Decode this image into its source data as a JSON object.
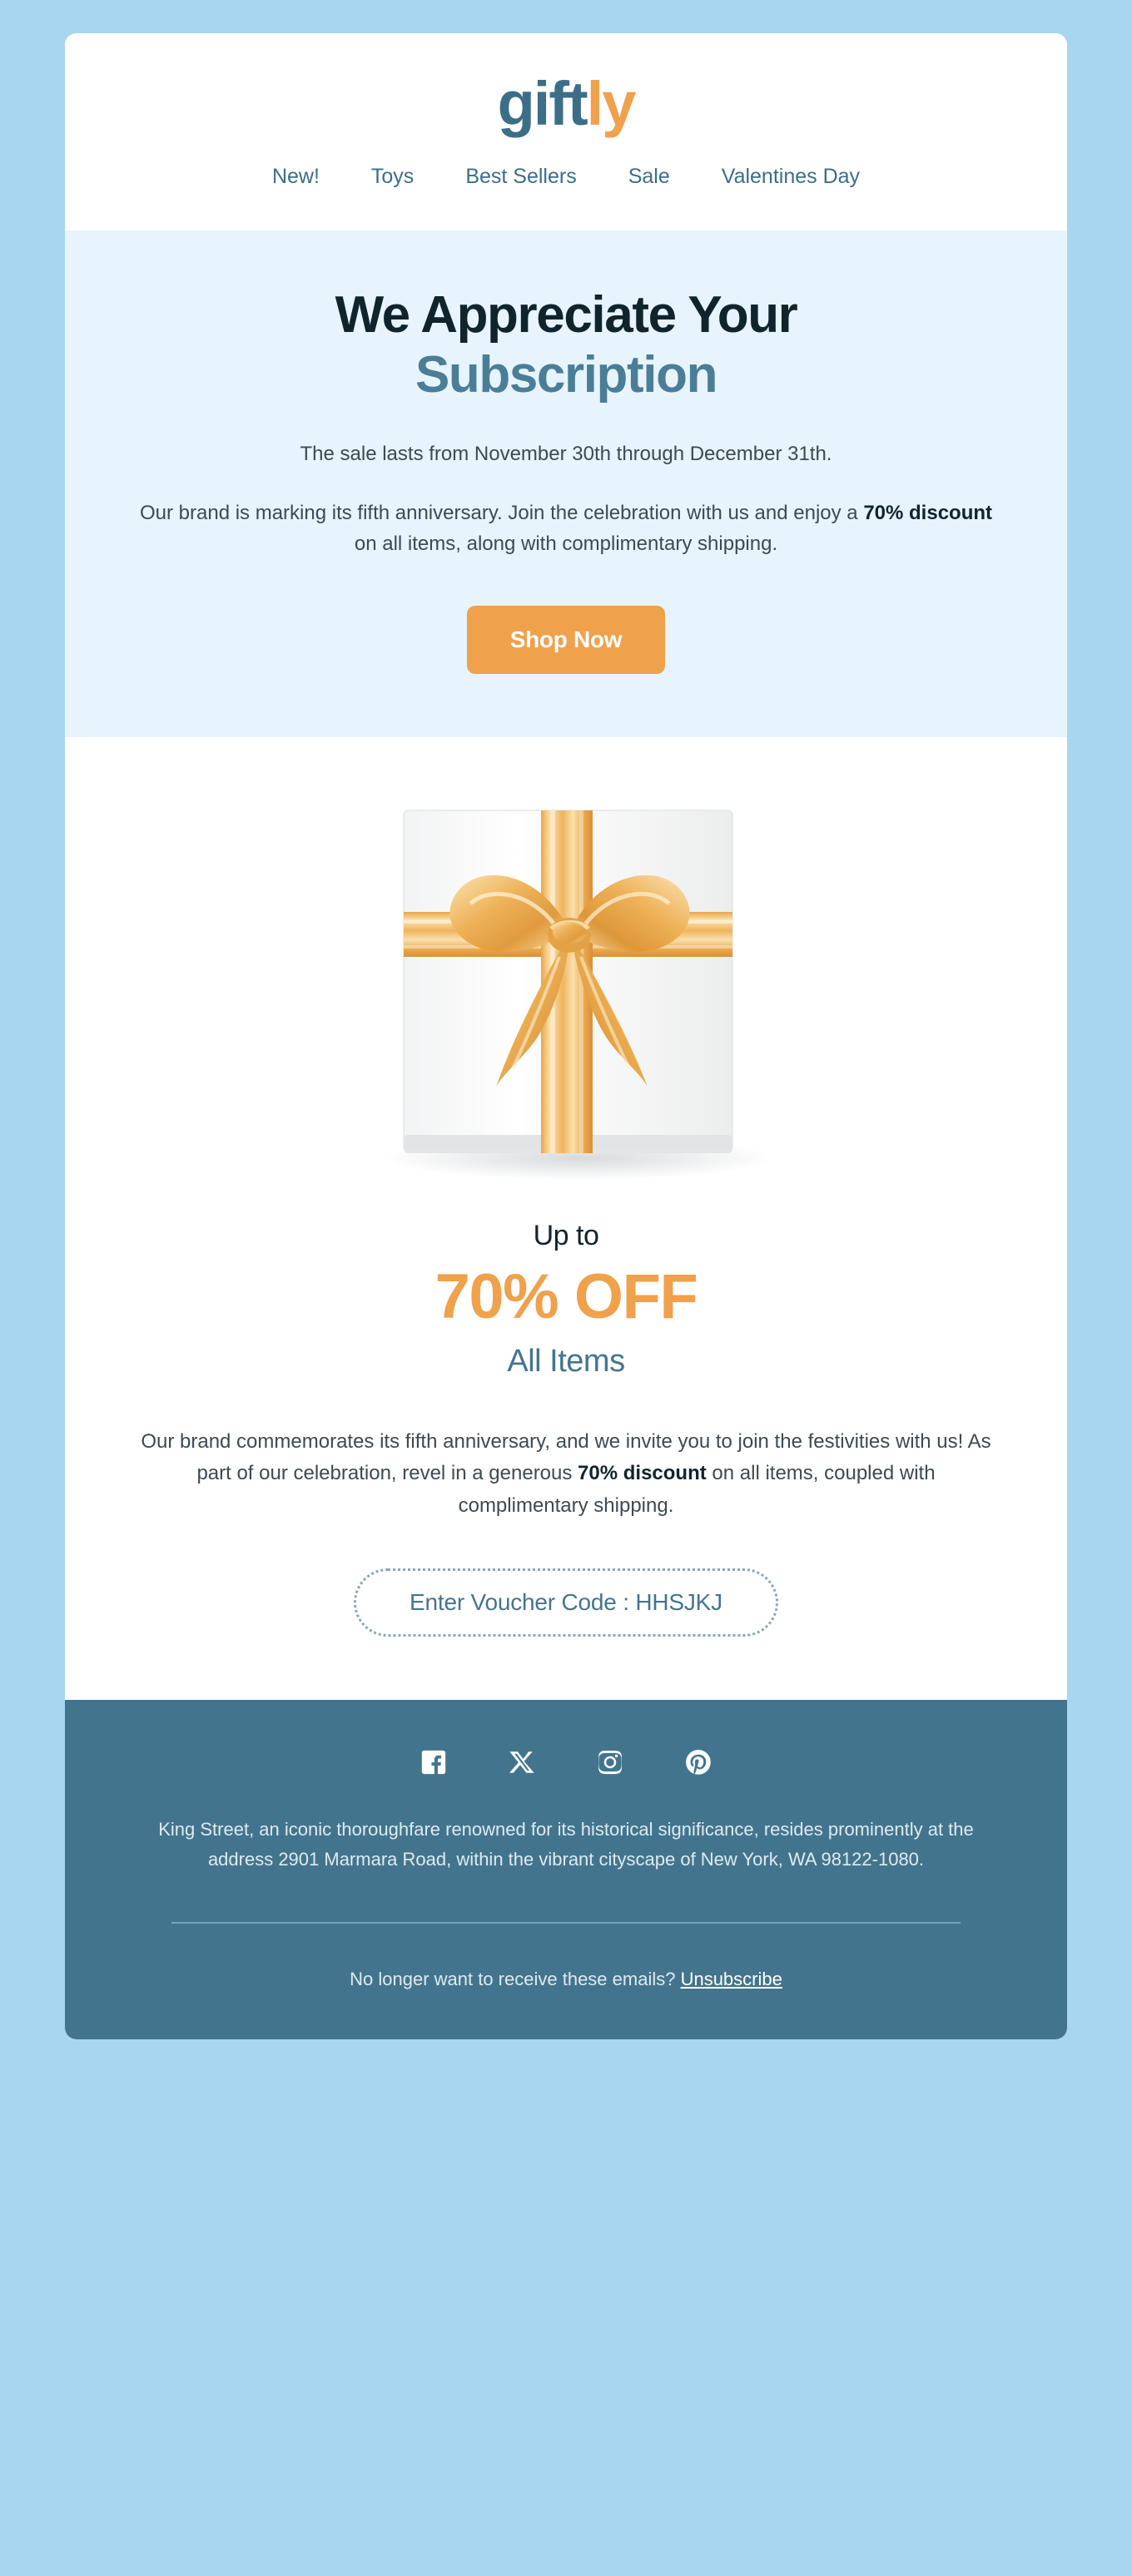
{
  "theme": {
    "page_background": "#a8d6f0",
    "card_background": "#ffffff",
    "hero_background": "#e7f4fd",
    "footer_background": "#42758d",
    "accent_orange": "#efa14c",
    "accent_slate": "#44758e",
    "heading_dark": "#10242e",
    "body_text": "#3d4a52"
  },
  "header": {
    "logo": {
      "part1": "gift",
      "part2": "ly",
      "part1_color": "#3c6e87",
      "part2_color": "#efa14c"
    },
    "nav": [
      {
        "label": "New!"
      },
      {
        "label": "Toys"
      },
      {
        "label": "Best Sellers"
      },
      {
        "label": "Sale"
      },
      {
        "label": "Valentines Day"
      }
    ]
  },
  "hero": {
    "title_line1": "We Appreciate Your",
    "title_line2": "Subscription",
    "dates": "The sale lasts from November 30th through December 31th.",
    "body_before": "Our brand is marking its fifth anniversary. Join the celebration with us and enjoy a ",
    "body_bold": "70% discount",
    "body_after": " on all items, along with complimentary shipping.",
    "cta_label": "Shop Now"
  },
  "product": {
    "image_alt": "white-gift-box-with-gold-ribbon",
    "upto_label": "Up to",
    "discount_headline": "70% OFF",
    "scope_label": "All Items",
    "body_before": "Our brand commemorates its fifth anniversary, and we invite you to join the festivities with us! As part of our celebration, revel in a generous ",
    "body_bold": "70% discount",
    "body_after": " on all items, coupled with complimentary shipping.",
    "voucher_label": "Enter Voucher Code : HHSJKJ"
  },
  "footer": {
    "socials": [
      {
        "name": "facebook-icon"
      },
      {
        "name": "x-twitter-icon"
      },
      {
        "name": "instagram-icon"
      },
      {
        "name": "pinterest-icon"
      }
    ],
    "address": "King Street, an iconic thoroughfare renowned for its historical significance, resides prominently at the address 2901 Marmara Road, within the vibrant cityscape of New York, WA 98122-1080.",
    "unsubscribe_prefix": "No longer want to receive these emails? ",
    "unsubscribe_label": "Unsubscribe"
  }
}
